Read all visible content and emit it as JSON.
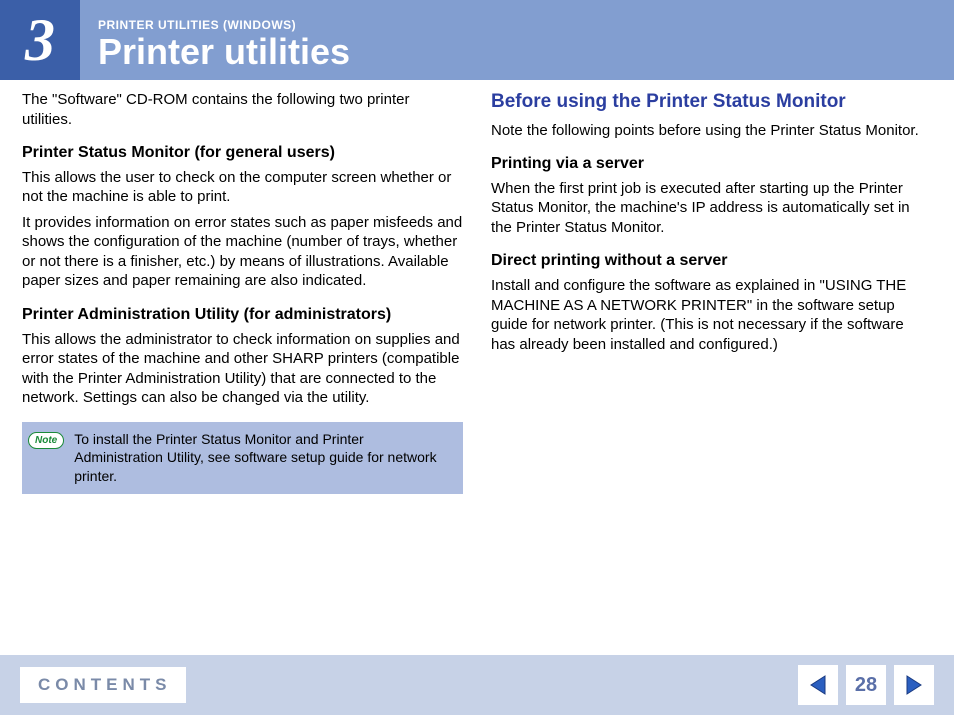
{
  "header": {
    "chapter_number": "3",
    "breadcrumb": "PRINTER UTILITIES (WINDOWS)",
    "title": "Printer utilities"
  },
  "left": {
    "intro": "The \"Software\" CD-ROM contains the following two printer utilities.",
    "h1": "Printer Status Monitor (for general users)",
    "p1a": "This allows the user to check on the computer screen whether or not the machine is able to print.",
    "p1b": "It provides information on error states such as paper misfeeds and shows the configuration of the machine (number of trays, whether or not there is a finisher, etc.) by means of illustrations. Available paper sizes and paper remaining are also indicated.",
    "h2": "Printer Administration Utility (for administrators)",
    "p2": "This allows the administrator to check information on supplies and error states of the machine and other SHARP printers (compatible with the Printer Administration Utility) that are connected to the network. Settings can also be changed via the utility.",
    "note_label": "Note",
    "note_text": "To install the Printer Status Monitor and Printer Administration Utility, see software setup guide for network printer."
  },
  "right": {
    "section": "Before using the Printer Status Monitor",
    "intro": "Note the following points before using the Printer Status Monitor.",
    "h1": "Printing via a server",
    "p1": "When the first print job is executed after starting up the Printer Status Monitor, the machine's IP address is automatically set in the Printer Status Monitor.",
    "h2": "Direct printing without a server",
    "p2": "Install and configure the software as explained in \"USING THE MACHINE AS A NETWORK PRINTER\" in the software setup guide for network printer. (This is not necessary if the software has already been installed and configured.)"
  },
  "footer": {
    "contents": "CONTENTS",
    "page": "28"
  }
}
